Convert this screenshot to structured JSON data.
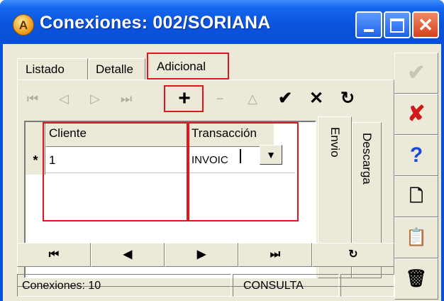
{
  "window": {
    "title": "Conexiones: 002/SORIANA",
    "app_icon_letter": "A",
    "controls": {
      "minimize": "minimize",
      "maximize": "maximize",
      "close": "✕"
    }
  },
  "tabs": [
    {
      "label": "Listado",
      "active": false
    },
    {
      "label": "Detalle",
      "active": false
    },
    {
      "label": "Adicional",
      "active": true
    }
  ],
  "toolbar": {
    "first": "⏮",
    "prior": "◁",
    "next": "▷",
    "last": "⏭",
    "insert": "+",
    "delete": "−",
    "edit": "△",
    "post": "✔",
    "cancel": "✕",
    "refresh": "↻"
  },
  "grid": {
    "indicator": "*",
    "columns": [
      "Cliente",
      "Transacción"
    ],
    "rows": [
      {
        "cliente": "1",
        "transaccion": "INVOIC"
      }
    ],
    "dropdown_arrow": "▼"
  },
  "side_tabs": {
    "envio": "Envio",
    "descarga": "Descarga"
  },
  "bottom_nav": {
    "first": "⏮",
    "prior": "◀",
    "next": "▶",
    "last": "⏭",
    "refresh": "↻"
  },
  "status": {
    "count": "Conexiones: 10",
    "mode": "CONSULTA",
    "extra": ""
  },
  "right_toolbar": {
    "accept": "✔",
    "cancel": "✘",
    "help": "?",
    "new": "🗋",
    "copy": "📋",
    "delete": "🗑"
  },
  "colors": {
    "titlebar": "#0a54dc",
    "highlight": "#e0161e",
    "face": "#ece9d8"
  }
}
